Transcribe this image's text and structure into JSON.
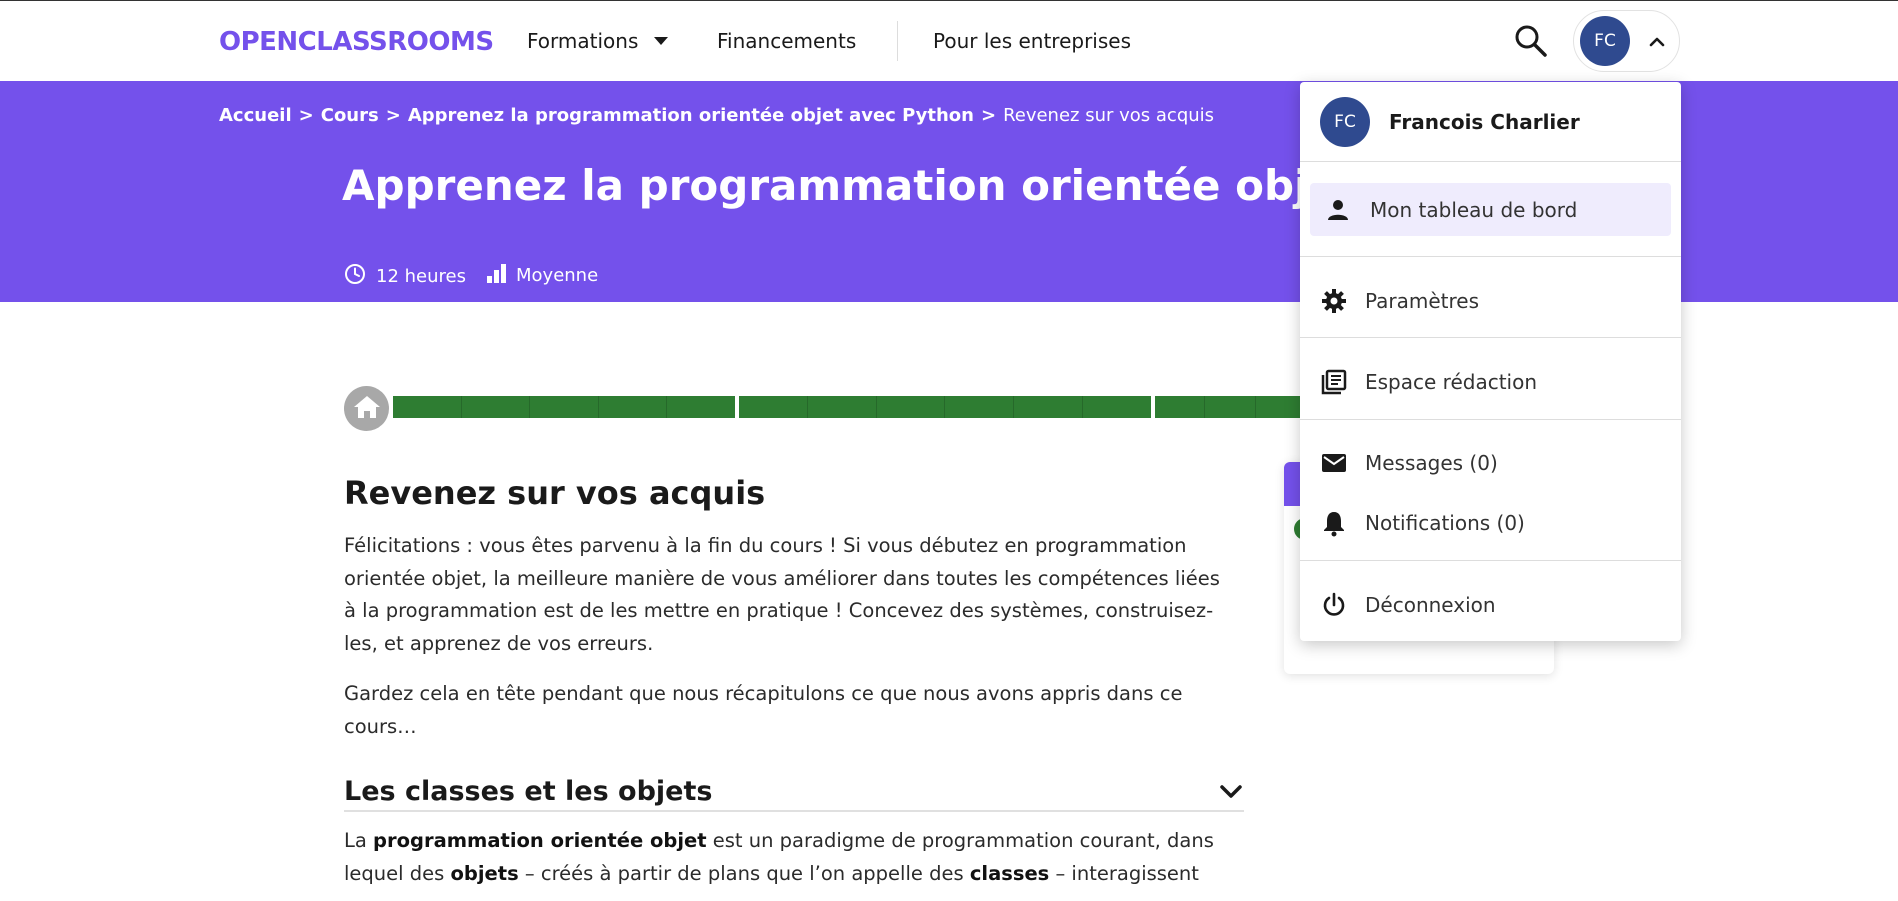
{
  "topbar": {
    "logo": "OPENCLASSROOMS",
    "nav": {
      "formations": "Formations",
      "financements": "Financements",
      "entreprises": "Pour les entreprises"
    },
    "user_initials": "FC"
  },
  "banner": {
    "breadcrumb": {
      "home": "Accueil",
      "cours": "Cours",
      "course": "Apprenez la programmation orientée objet avec Python",
      "current": "Revenez sur vos acquis",
      "sep": ">"
    },
    "title": "Apprenez la programmation orientée objet avec Python",
    "duration": "12 heures",
    "level": "Moyenne"
  },
  "content": {
    "chapter_title": "Revenez sur vos acquis",
    "para1": "Félicitations : vous êtes parvenu à la fin du cours ! Si vous débutez en programmation orientée objet, la meilleure manière de vous améliorer dans toutes les compétences liées à la programmation est de les mettre en pratique ! Concevez des systèmes, construisez-les, et apprenez de vos erreurs.",
    "para2": "Gardez cela en tête pendant que nous récapitulons ce que nous avons appris dans ce cours…",
    "section_title": "Les classes et les objets",
    "para3": {
      "t1": "La ",
      "b1": "programmation orientée objet",
      "t2": " est un paradigme de programmation courant, dans lequel des ",
      "b2": "objets",
      "t3": " – créés à partir de plans que l’on appelle des ",
      "b3": "classes",
      "t4": " – interagissent"
    }
  },
  "progress": {
    "completed_fraction": 1.0,
    "colors": {
      "done": "#2e7d32",
      "accent": "#7451eb"
    }
  },
  "menu": {
    "user_initials": "FC",
    "user_name": "Francois Charlier",
    "items": {
      "dashboard": "Mon tableau de bord",
      "settings": "Paramètres",
      "writing": "Espace rédaction",
      "messages": "Messages (0)",
      "notifications": "Notifications (0)",
      "logout": "Déconnexion"
    },
    "icons": [
      "person-icon",
      "gear-icon",
      "library-icon",
      "mail-icon",
      "bell-icon",
      "power-icon"
    ]
  }
}
